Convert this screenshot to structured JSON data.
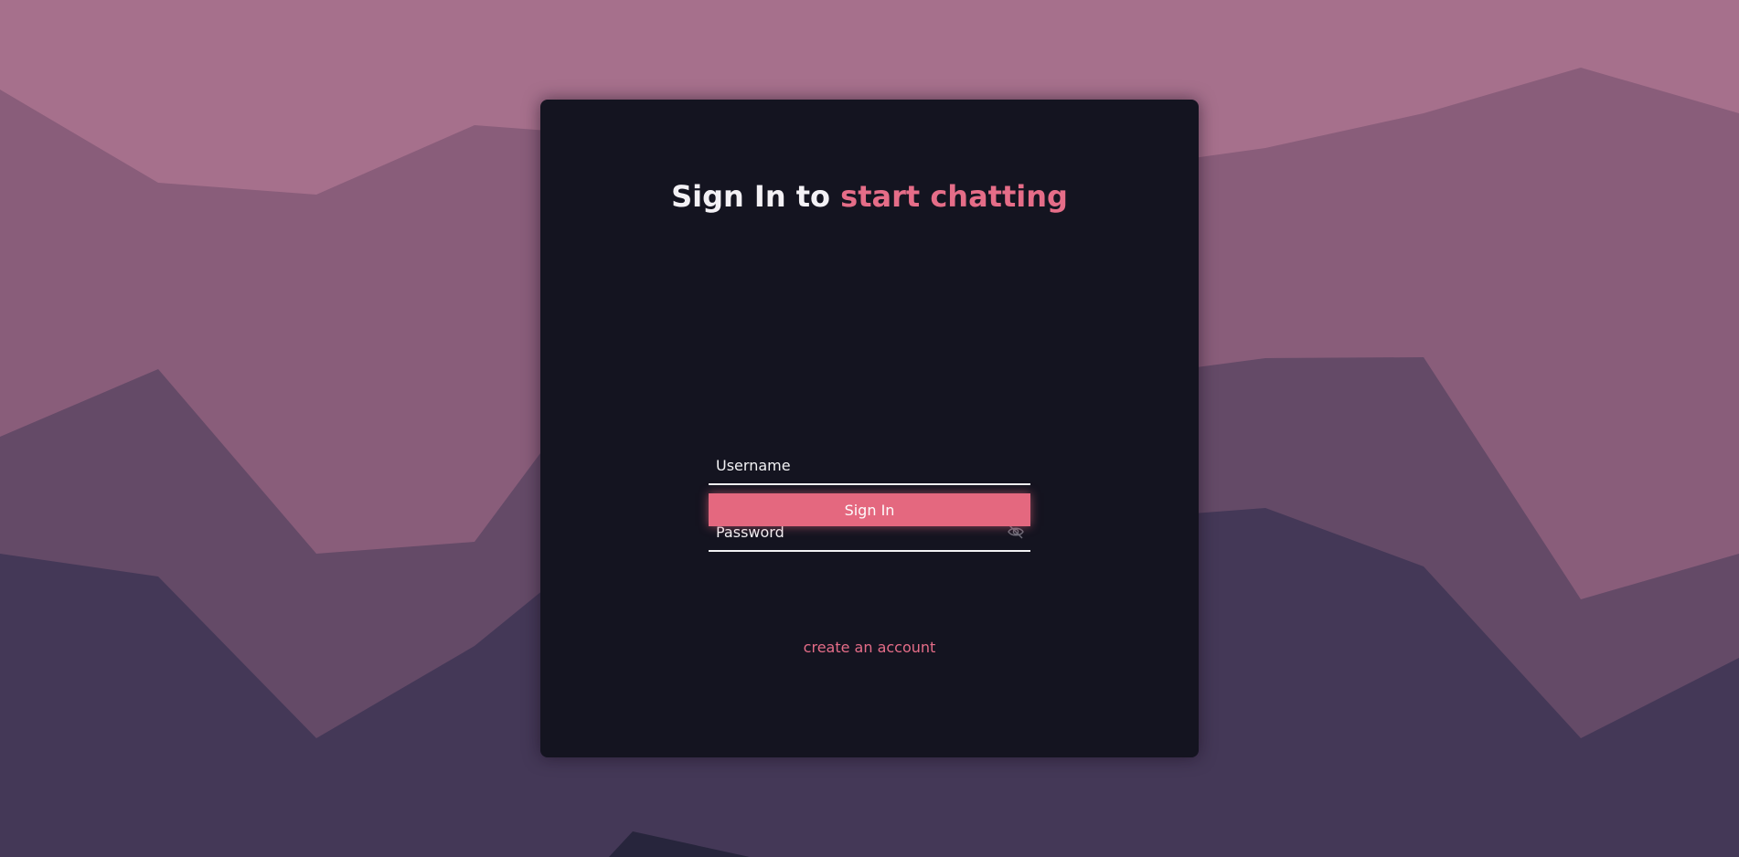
{
  "colors": {
    "accent": "#e56d88",
    "card_background": "#141420",
    "button_background": "#e4687f",
    "bg_top": "#a6708c",
    "bg_mid1": "#895d7a",
    "bg_mid2": "#644a67",
    "bg_mid3": "#443857",
    "bg_bottom": "#27253c"
  },
  "login": {
    "title_prefix": "Sign In to",
    "title_accent": "start chatting",
    "username_placeholder": "Username",
    "password_placeholder": "Password",
    "password_toggle_icon": "eye-off-icon",
    "submit_label": "Sign In",
    "create_account_label": "create an account"
  }
}
